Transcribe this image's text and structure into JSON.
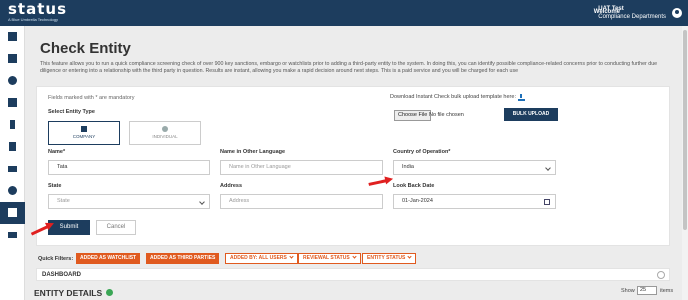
{
  "header": {
    "logo": "status",
    "logo_sub": "A Blue Umbrella Technology",
    "welcome": "Welcome",
    "user_name": "UAT Test",
    "user_dept": "Compliance Departments"
  },
  "sidebar": {
    "items": [
      {
        "icon": "table-icon"
      },
      {
        "icon": "grid-icon"
      },
      {
        "icon": "eye-icon"
      },
      {
        "icon": "document-edit-icon"
      },
      {
        "icon": "dollar-icon"
      },
      {
        "icon": "report-icon"
      },
      {
        "icon": "chart-icon"
      },
      {
        "icon": "gear-icon"
      },
      {
        "icon": "user-check-icon"
      },
      {
        "icon": "menu-icon"
      }
    ],
    "active_index": 8
  },
  "page": {
    "title": "Check Entity",
    "description": "This feature allows you to run a quick compliance screening check of over 900 key sanctions, embargo or watchlists prior to adding a third-party entity to the system. In doing this, you can identify possible compliance-related concerns prior to conducting further due diligence or entering into a relationship with the third party in question. Results are instant, allowing you make a rapid decision around next steps. This is a paid service and you will be charged for each use"
  },
  "form": {
    "mandatory_note": "Fields marked with * are mandatory",
    "entity_type_label": "Select Entity Type",
    "entity_types": [
      {
        "label": "COMPANY",
        "selected": true
      },
      {
        "label": "INDIVIDUAL",
        "selected": false
      }
    ],
    "download_text": "Download Instant Check bulk upload template here:",
    "choose_file": "Choose File",
    "no_file": "No file chosen",
    "bulk_upload": "BULK UPLOAD",
    "name_label": "Name*",
    "name_value": "Tata",
    "other_lang_label": "Name in Other Language",
    "other_lang_placeholder": "Name in Other Language",
    "country_label": "Country of Operation*",
    "country_value": "India",
    "state_label": "State",
    "state_value": "State",
    "address_label": "Address",
    "address_placeholder": "Address",
    "lookback_label": "Look Back Date",
    "lookback_value": "01-Jan-2024",
    "submit": "Submit",
    "cancel": "Cancel"
  },
  "quick_filters": {
    "label": "Quick Filters:",
    "chips": [
      {
        "label": "ADDED AS WATCHLIST",
        "style": "solid"
      },
      {
        "label": "ADDED AS THIRD PARTIES",
        "style": "solid"
      },
      {
        "label": "ADDED BY: ALL USERS",
        "style": "outline"
      },
      {
        "label": "REVIEWAL STATUS",
        "style": "outline"
      },
      {
        "label": "ENTITY STATUS",
        "style": "outline"
      }
    ]
  },
  "dashboard": {
    "label": "DASHBOARD"
  },
  "entity_details": {
    "title": "ENTITY DETAILS",
    "show_label": "Show",
    "show_value": "25",
    "items_label": "items"
  },
  "colors": {
    "primary": "#1d3d5e",
    "accent": "#e05a1f",
    "annotation_arrow": "#e02020"
  }
}
